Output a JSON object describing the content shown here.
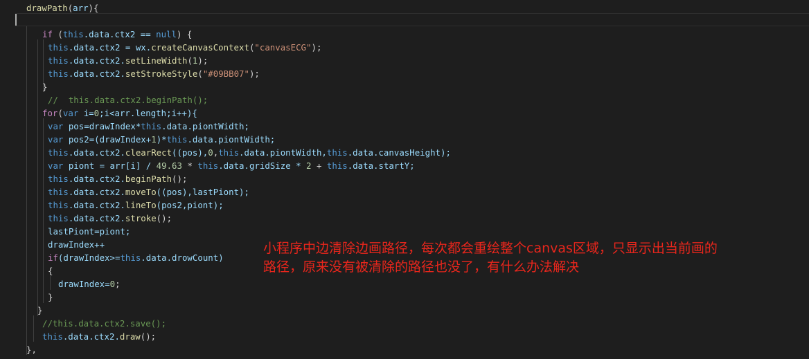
{
  "annotation": {
    "line1": "小程序中边清除边画路径，每次都会重绘整个canvas区域，只显示出当前画的",
    "line2": "路径，原来没有被清除的路径也没了，有什么办法解决"
  },
  "code": {
    "L1": {
      "a": "drawPath",
      "b": "(",
      "c": "arr",
      "d": "){"
    },
    "L3": {
      "a": "if",
      "b": " (",
      "c": "this",
      "d": ".data.ctx2 == ",
      "e": "null",
      "f": ") {"
    },
    "L4": {
      "a": "this",
      "b": ".data.ctx2 = wx.",
      "c": "createCanvasContext",
      "d": "(",
      "e": "\"canvasECG\"",
      "f": ");"
    },
    "L5": {
      "a": "this",
      "b": ".data.ctx2.",
      "c": "setLineWidth",
      "d": "(",
      "e": "1",
      "f": ");"
    },
    "L6": {
      "a": "this",
      "b": ".data.ctx2.",
      "c": "setStrokeStyle",
      "d": "(",
      "e": "\"#09BB07\"",
      "f": ");"
    },
    "L7": {
      "a": "}"
    },
    "L8": {
      "a": "//  this.data.ctx2.beginPath();"
    },
    "L9": {
      "a": "for",
      "b": "(",
      "c": "var",
      "d": " i=",
      "e": "0",
      "f": ";i<arr.length;i++){"
    },
    "L10": {
      "a": "var",
      "b": " pos=drawIndex*",
      "c": "this",
      "d": ".data.piontWidth;"
    },
    "L11": {
      "a": "var",
      "b": " pos2=(drawIndex+",
      "c": "1",
      "d": ")*",
      "e": "this",
      "f": ".data.piontWidth;"
    },
    "L12": {
      "a": "this",
      "b": ".data.ctx2.",
      "c": "clearRect",
      "d": "((pos),",
      "e": "0",
      "f": ",",
      "g": "this",
      "h": ".data.piontWidth,",
      "i": "this",
      "j": ".data.canvasHeight);"
    },
    "L13": {
      "a": "var",
      "b": " piont = arr[i] / ",
      "c": "49.63",
      "d": " * ",
      "e": "this",
      "f": ".data.gridSize * ",
      "g": "2",
      "h": " + ",
      "i": "this",
      "j": ".data.startY;"
    },
    "L14": {
      "a": "this",
      "b": ".data.ctx2.",
      "c": "beginPath",
      "d": "();"
    },
    "L15": {
      "a": "this",
      "b": ".data.ctx2.",
      "c": "moveTo",
      "d": "((pos),lastPiont);"
    },
    "L16": {
      "a": "this",
      "b": ".data.ctx2.",
      "c": "lineTo",
      "d": "(pos2,piont);"
    },
    "L17": {
      "a": "this",
      "b": ".data.ctx2.",
      "c": "stroke",
      "d": "();"
    },
    "L18": {
      "a": "lastPiont=piont;"
    },
    "L19": {
      "a": "drawIndex++"
    },
    "L20": {
      "a": "if",
      "b": "(drawIndex>=",
      "c": "this",
      "d": ".data.drowCount)"
    },
    "L21": {
      "a": "{"
    },
    "L22": {
      "a": "drawIndex=",
      "b": "0",
      "c": ";"
    },
    "L23": {
      "a": "}"
    },
    "L24": {
      "a": "}"
    },
    "L25": {
      "a": "//this.data.ctx2.save();"
    },
    "L26": {
      "a": "this",
      "b": ".data.ctx2.",
      "c": "draw",
      "d": "();"
    },
    "L27": {
      "a": "},"
    }
  }
}
